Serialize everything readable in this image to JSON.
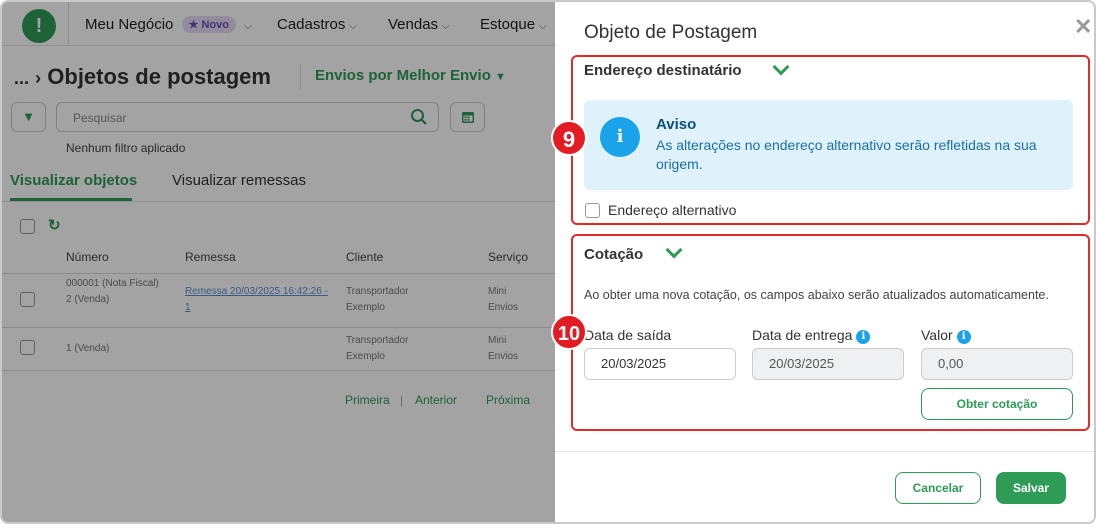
{
  "app": {
    "logo": "!",
    "menu": [
      {
        "label": "Meu Negócio",
        "badge": "Novo"
      },
      {
        "label": "Cadastros"
      },
      {
        "label": "Vendas"
      },
      {
        "label": "Estoque"
      }
    ],
    "breadcrumb_ellipsis": "...",
    "page_title": "Objetos de postagem",
    "envios_dropdown": "Envios por Melhor Envio",
    "search_placeholder": "Pesquisar",
    "no_filter": "Nenhum filtro aplicado",
    "tabs": [
      "Visualizar objetos",
      "Visualizar remessas"
    ],
    "table": {
      "headers": [
        "Número",
        "Remessa",
        "Cliente",
        "Serviço"
      ],
      "rows": [
        {
          "numero": "000001 (Nota Fiscal)\n2 (Venda)",
          "remessa": "Remessa 20/03/2025 16:42:26 - 1",
          "cliente": "Transportador Exemplo",
          "servico": "Mini Envios"
        },
        {
          "numero": "1 (Venda)",
          "remessa": "",
          "cliente": "Transportador Exemplo",
          "servico": "Mini Envios"
        }
      ]
    },
    "pager": [
      "Primeira",
      "Anterior",
      "Próxima"
    ]
  },
  "modal": {
    "title": "Objeto de Postagem",
    "close": "✕",
    "endereco": {
      "title": "Endereço destinatário",
      "aviso_title": "Aviso",
      "aviso_text": "As alterações no endereço alternativo serão refletidas na sua origem.",
      "alt_label": "Endereço alternativo"
    },
    "cotacao": {
      "title": "Cotação",
      "note": "Ao obter uma nova cotação, os campos abaixo serão atualizados automaticamente.",
      "data_saida_label": "Data de saída",
      "data_saida_value": "20/03/2025",
      "data_entrega_label": "Data de entrega",
      "data_entrega_value": "20/03/2025",
      "valor_label": "Valor",
      "valor_value": "0,00",
      "obter_button": "Obter cotação"
    },
    "cancel_button": "Cancelar",
    "save_button": "Salvar"
  },
  "steps": [
    "9",
    "10"
  ],
  "colors": {
    "brand_green": "#2e9b57",
    "info_blue": "#1aa3e8",
    "highlight_red": "#e02b2b"
  }
}
